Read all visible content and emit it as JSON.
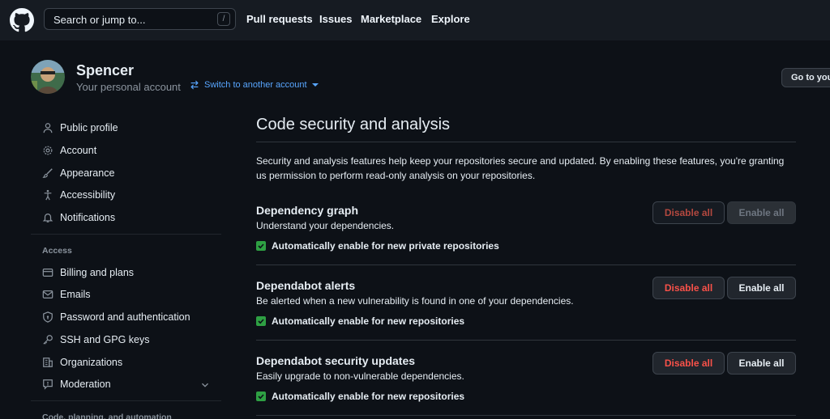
{
  "header": {
    "search_placeholder": "Search or jump to...",
    "search_shortcut": "/",
    "nav": [
      "Pull requests",
      "Issues",
      "Marketplace",
      "Explore"
    ]
  },
  "account": {
    "name": "Spencer",
    "subtitle": "Your personal account",
    "switch_label": "Switch to another account",
    "goto_label": "Go to your personal profile"
  },
  "sidebar": {
    "items": [
      {
        "label": "Public profile",
        "icon": "person-icon"
      },
      {
        "label": "Account",
        "icon": "gear-icon"
      },
      {
        "label": "Appearance",
        "icon": "paintbrush-icon"
      },
      {
        "label": "Accessibility",
        "icon": "accessibility-icon"
      },
      {
        "label": "Notifications",
        "icon": "bell-icon"
      }
    ],
    "access_heading": "Access",
    "access_items": [
      {
        "label": "Billing and plans",
        "icon": "credit-card-icon"
      },
      {
        "label": "Emails",
        "icon": "mail-icon"
      },
      {
        "label": "Password and authentication",
        "icon": "shield-lock-icon"
      },
      {
        "label": "SSH and GPG keys",
        "icon": "key-icon"
      },
      {
        "label": "Organizations",
        "icon": "organization-icon"
      },
      {
        "label": "Moderation",
        "icon": "report-icon"
      }
    ],
    "code_heading": "Code, planning, and automation"
  },
  "main": {
    "title": "Code security and analysis",
    "intro": "Security and analysis features help keep your repositories secure and updated. By enabling these features, you're granting us permission to perform read-only analysis on your repositories.",
    "sections": [
      {
        "title": "Dependency graph",
        "description": "Understand your dependencies.",
        "checkbox_label": "Automatically enable for new private repositories",
        "checked": true,
        "disable_label": "Disable all",
        "enable_label": "Enable all"
      },
      {
        "title": "Dependabot alerts",
        "description": "Be alerted when a new vulnerability is found in one of your dependencies.",
        "checkbox_label": "Automatically enable for new repositories",
        "checked": true,
        "disable_label": "Disable all",
        "enable_label": "Enable all"
      },
      {
        "title": "Dependabot security updates",
        "description": "Easily upgrade to non-vulnerable dependencies.",
        "checkbox_label": "Automatically enable for new repositories",
        "checked": true,
        "disable_label": "Disable all",
        "enable_label": "Enable all"
      }
    ]
  },
  "colors": {
    "background": "#0d1117",
    "header": "#161b22",
    "link": "#58a6ff",
    "danger": "#f85149",
    "success": "#2ea043"
  }
}
